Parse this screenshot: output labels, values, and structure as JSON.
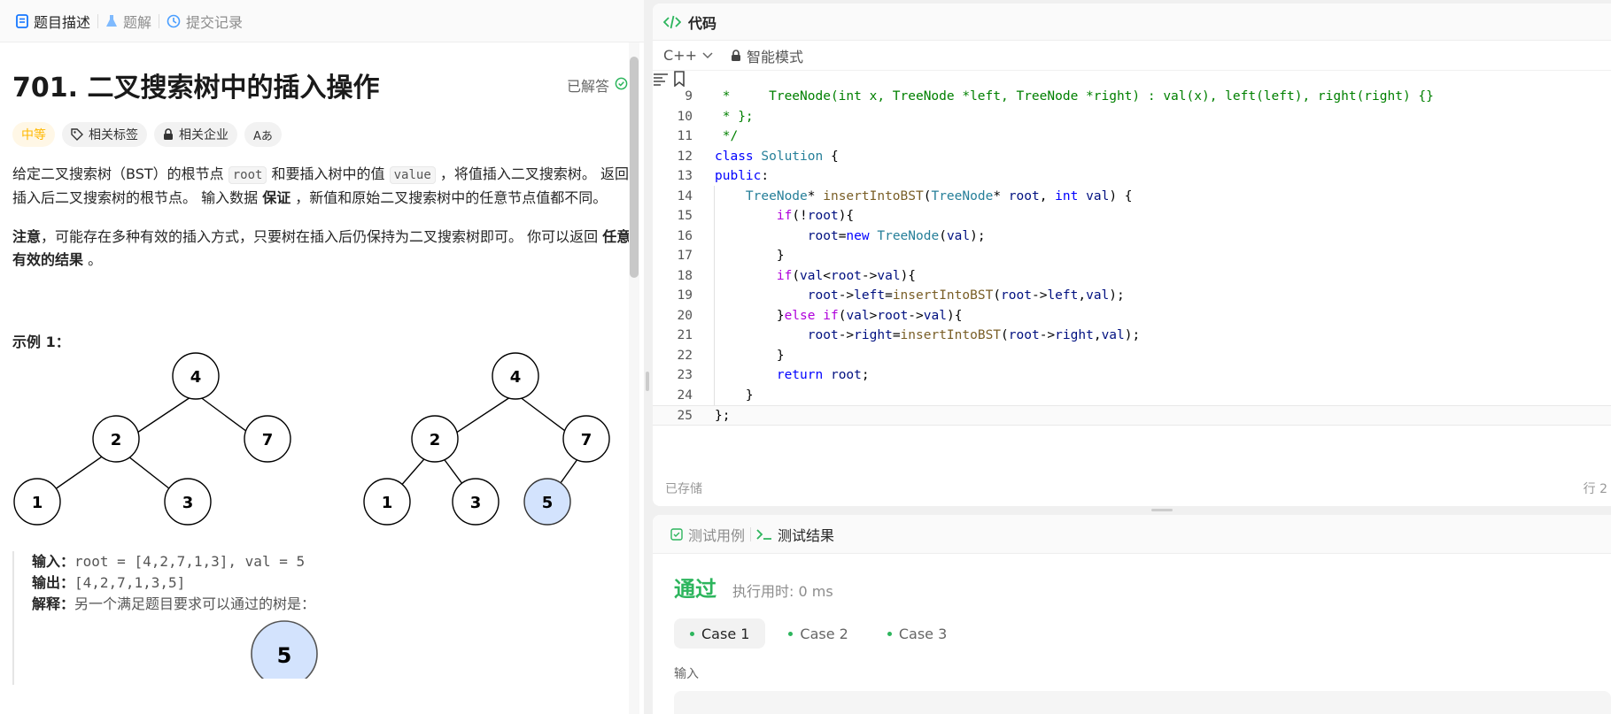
{
  "left_tabs": [
    {
      "label": "题目描述"
    },
    {
      "label": "题解"
    },
    {
      "label": "提交记录"
    }
  ],
  "problem": {
    "title": "701. 二叉搜索树中的插入操作",
    "solved_label": "已解答",
    "tags": {
      "difficulty": "中等",
      "related_tags": "相关标签",
      "related_companies": "相关企业",
      "font": "Aあ"
    },
    "desc": {
      "p1_a": "给定二叉搜索树（BST）的根节点 ",
      "p1_code1": "root",
      "p1_b": " 和要插入树中的值 ",
      "p1_code2": "value",
      "p1_c": " ，将值插入二叉搜索树。 返回插入后二叉搜索树的根节点。 输入数据 ",
      "p1_bold": "保证",
      "p1_d": " ，新值和原始二叉搜索树中的任意节点值都不同。",
      "p2_bold": "注意",
      "p2_a": "，可能存在多种有效的插入方式，只要树在插入后仍保持为二叉搜索树即可。 你可以返回 ",
      "p2_bold2": "任意有效的结果",
      "p2_b": " 。"
    },
    "example_title": "示例 1：",
    "tree1": {
      "nodes": [
        "4",
        "2",
        "7",
        "1",
        "3"
      ]
    },
    "tree2": {
      "nodes": [
        "4",
        "2",
        "7",
        "1",
        "3",
        "5"
      ]
    },
    "example": {
      "input_label": "输入：",
      "input_value": "root = [4,2,7,1,3], val = 5",
      "output_label": "输出：",
      "output_value": "[4,2,7,1,3,5]",
      "explain_label": "解释：",
      "explain_value": "另一个满足题目要求可以通过的树是：",
      "extra_node": "5"
    }
  },
  "code_panel": {
    "title": "代码",
    "language": "C++",
    "mode": "智能模式",
    "saved": "已存储",
    "cursor": "行 2"
  },
  "code_lines": [
    {
      "n": "9",
      "t": " *     TreeNode(int x, TreeNode *left, TreeNode *right) : val(x), left(left), right(right) {}"
    },
    {
      "n": "10",
      "t": " * };"
    },
    {
      "n": "11",
      "t": " */"
    },
    {
      "n": "12",
      "t": "class Solution {"
    },
    {
      "n": "13",
      "t": "public:"
    },
    {
      "n": "14",
      "t": "    TreeNode* insertIntoBST(TreeNode* root, int val) {"
    },
    {
      "n": "15",
      "t": "        if(!root){"
    },
    {
      "n": "16",
      "t": "            root=new TreeNode(val);"
    },
    {
      "n": "17",
      "t": "        }"
    },
    {
      "n": "18",
      "t": "        if(val<root->val){"
    },
    {
      "n": "19",
      "t": "            root->left=insertIntoBST(root->left,val);"
    },
    {
      "n": "20",
      "t": "        }else if(val>root->val){"
    },
    {
      "n": "21",
      "t": "            root->right=insertIntoBST(root->right,val);"
    },
    {
      "n": "22",
      "t": "        }"
    },
    {
      "n": "23",
      "t": "        return root;"
    },
    {
      "n": "24",
      "t": "    }"
    },
    {
      "n": "25",
      "t": "};"
    }
  ],
  "test_panel": {
    "tab_cases": "测试用例",
    "tab_results": "测试结果",
    "status": "通过",
    "runtime": "执行用时: 0 ms",
    "cases": [
      "Case 1",
      "Case 2",
      "Case 3"
    ],
    "input_label": "输入"
  },
  "colors": {
    "accent_green": "#2db55d",
    "difficulty": "#ffb800",
    "node_highlight": "#d3e3fd"
  }
}
